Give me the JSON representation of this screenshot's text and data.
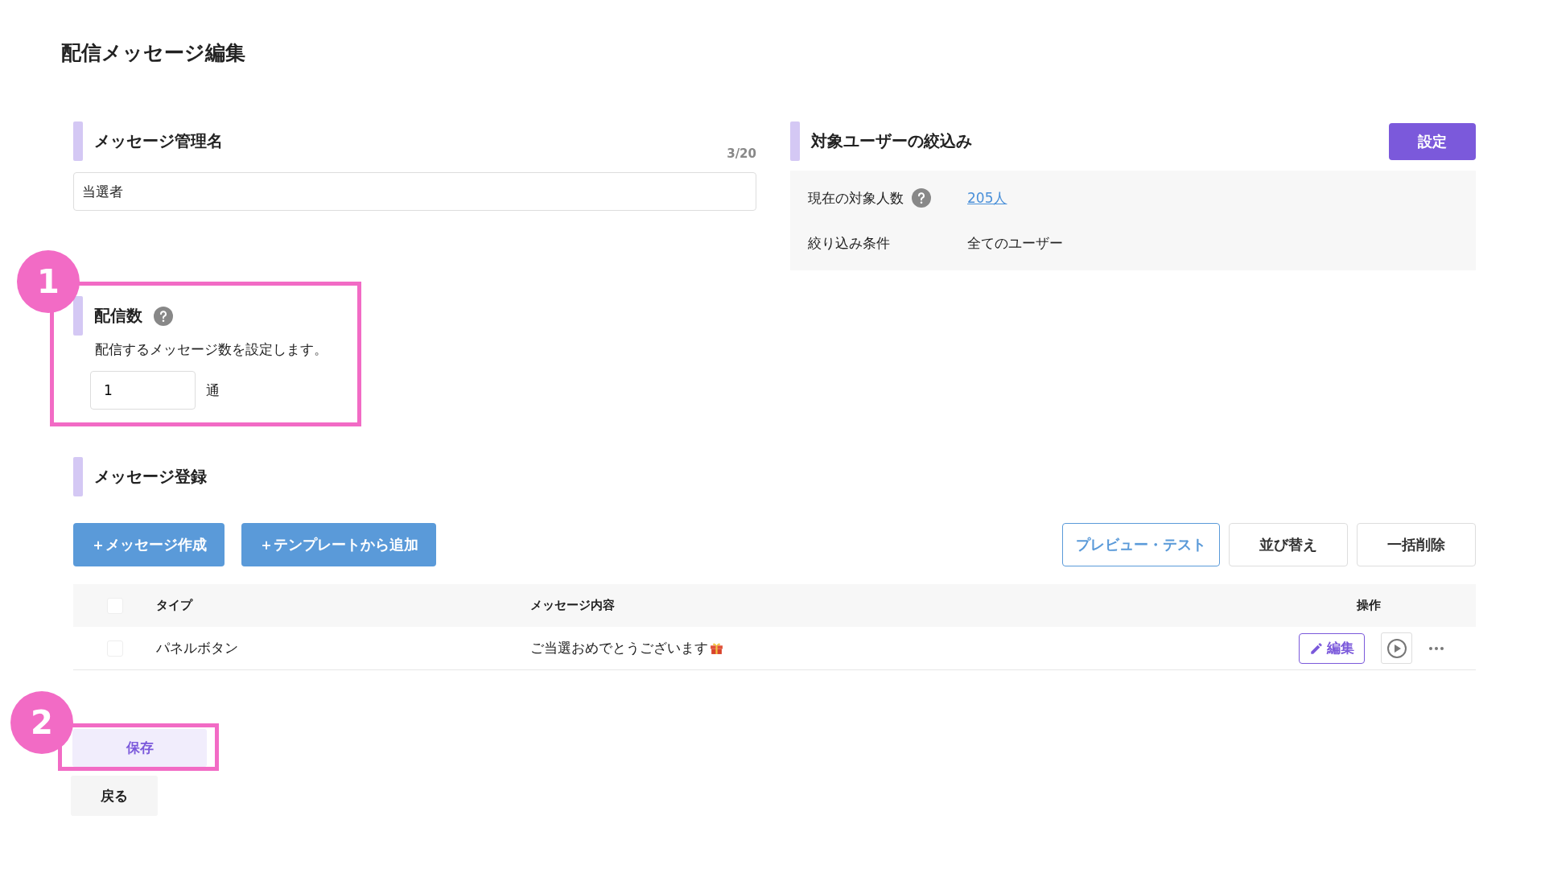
{
  "page": {
    "title": "配信メッセージ編集"
  },
  "message_name": {
    "heading": "メッセージ管理名",
    "counter": "3/20",
    "value": "当選者"
  },
  "target_users": {
    "heading": "対象ユーザーの絞込み",
    "button": "設定",
    "rows": [
      {
        "label": "現在の対象人数",
        "help": true,
        "value": "205人",
        "kind": "link"
      },
      {
        "label": "絞り込み条件",
        "help": false,
        "value": "全てのユーザー",
        "kind": "text"
      }
    ]
  },
  "delivery_count": {
    "heading": "配信数",
    "help": true,
    "description": "配信するメッセージ数を設定します。",
    "value": "1",
    "unit": "通"
  },
  "messages": {
    "heading": "メッセージ登録",
    "left_buttons": [
      "＋メッセージ作成",
      "＋テンプレートから追加"
    ],
    "right_buttons": [
      {
        "label": "プレビュー・テスト",
        "kind": "outline"
      },
      {
        "label": "並び替え",
        "kind": "plain"
      },
      {
        "label": "一括削除",
        "kind": "plain"
      }
    ],
    "columns": [
      "タイプ",
      "メッセージ内容",
      "操作"
    ],
    "header_checked": false,
    "rows": [
      {
        "checked": false,
        "type": "パネルボタン",
        "content": "ご当選おめでとうございます",
        "edit": "編集"
      }
    ]
  },
  "footer": {
    "save": "保存",
    "back": "戻る"
  },
  "annotations": [
    {
      "label": "1"
    },
    {
      "label": "2"
    }
  ]
}
